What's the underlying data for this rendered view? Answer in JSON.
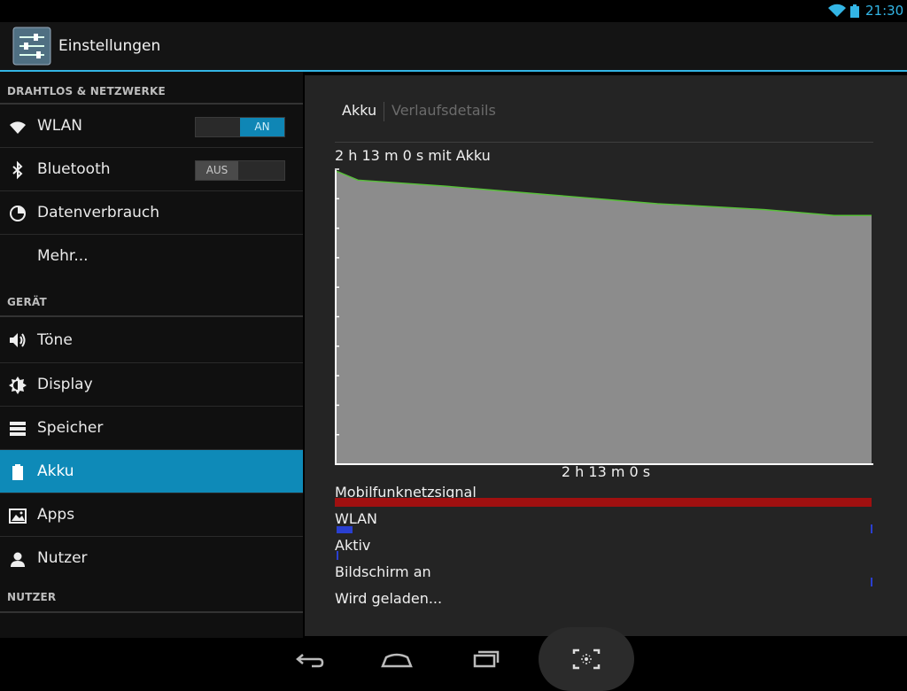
{
  "status_bar": {
    "time": "21:30",
    "accent": "#33b5e5"
  },
  "action_bar": {
    "title": "Einstellungen",
    "icon": "settings-sliders-icon"
  },
  "sidebar": {
    "sections": [
      {
        "header": "DRAHTLOS & NETZWERKE"
      },
      {
        "header": "GERÄT"
      },
      {
        "header": "NUTZER"
      }
    ],
    "items": [
      {
        "label": "WLAN",
        "icon": "wifi-icon",
        "toggle": "AN",
        "toggle_on": true
      },
      {
        "label": "Bluetooth",
        "icon": "bluetooth-icon",
        "toggle": "AUS",
        "toggle_on": false
      },
      {
        "label": "Datenverbrauch",
        "icon": "data-usage-icon"
      },
      {
        "label": "Mehr...",
        "icon": ""
      },
      {
        "label": "Töne",
        "icon": "speaker-icon"
      },
      {
        "label": "Display",
        "icon": "brightness-icon"
      },
      {
        "label": "Speicher",
        "icon": "storage-icon"
      },
      {
        "label": "Akku",
        "icon": "battery-icon",
        "selected": true
      },
      {
        "label": "Apps",
        "icon": "apps-icon"
      },
      {
        "label": "Nutzer",
        "icon": "user-icon"
      }
    ]
  },
  "panel": {
    "tabs": [
      "Akku",
      "Verlaufsdetails"
    ],
    "duration_text": "2 h 13 m 0 s mit Akku",
    "x_label": "2 h 13 m 0 s",
    "signals": [
      "Mobilfunknetzsignal",
      "WLAN",
      "Aktiv",
      "Bildschirm an",
      "Wird geladen..."
    ]
  },
  "chart_data": {
    "type": "area",
    "y_unit": "battery level",
    "line_color": "#58c03a",
    "fill_color": "#8c8c8c",
    "x": [
      0,
      0.04,
      0.2,
      0.4,
      0.6,
      0.8,
      0.93,
      1.0
    ],
    "values": [
      0.99,
      0.96,
      0.94,
      0.91,
      0.88,
      0.86,
      0.84,
      0.84
    ],
    "ylim": [
      0,
      1
    ]
  },
  "signal_bars": {
    "Mobilfunknetzsignal": {
      "color": "#a01010",
      "fraction": 1.0
    },
    "WLAN": {
      "color": "#2a3fd0",
      "fraction": 0.03
    },
    "Aktiv": {
      "color": "#2a3fd0",
      "fraction": 0.004
    },
    "Bildschirm an": {
      "color": "#2a3fd0",
      "fraction": 0.002
    }
  },
  "nav_bar": {
    "buttons": [
      "back-icon",
      "home-icon",
      "recent-apps-icon",
      "screenshot-icon"
    ]
  }
}
